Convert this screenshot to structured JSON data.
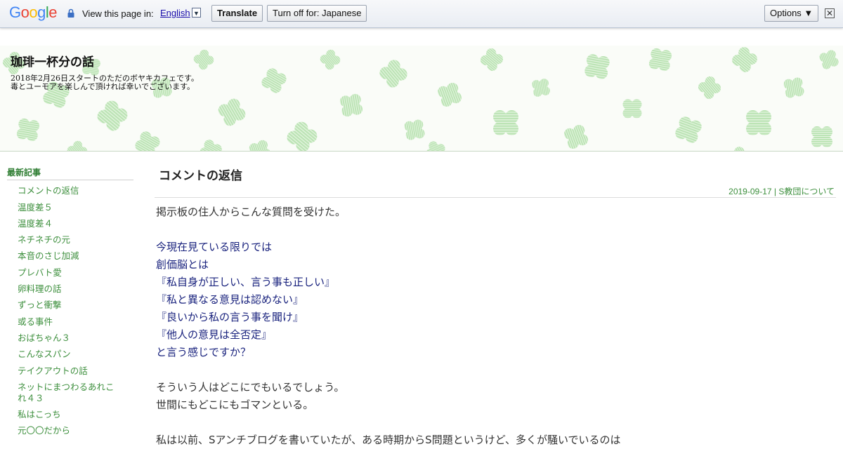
{
  "translate_bar": {
    "logo": "Google",
    "view_label": "View this page in:",
    "language": "English",
    "translate_button": "Translate",
    "turn_off_button": "Turn off for: Japanese",
    "options_button": "Options ▼",
    "close_symbol": "✕"
  },
  "header": {
    "title": "珈琲一杯分の話",
    "description_line1": "2018年2月26日スタートのただのボヤキカフェです。",
    "description_line2": "毒とユーモアを楽しんで頂ければ幸いでございます。"
  },
  "sidebar": {
    "heading": "最新記事",
    "items": [
      "コメントの返信",
      "温度差５",
      "温度差４",
      "ネチネチの元",
      "本音のさじ加減",
      "プレバト愛",
      "卵料理の話",
      "ずっと衝撃",
      "或る事件",
      "おばちゃん３",
      "こんなスパン",
      "テイクアウトの話",
      "ネットにまつわるあれこれ４３",
      "私はこっち",
      "元〇〇だから"
    ]
  },
  "post": {
    "title": "コメントの返信",
    "date": "2019-09-17",
    "separator": " | ",
    "category": "S教団について",
    "lines": [
      {
        "text": "掲示板の住人からこんな質問を受けた。",
        "style": "n"
      },
      {
        "text": "",
        "style": "gap"
      },
      {
        "text": "今現在見ている限りでは",
        "style": "q"
      },
      {
        "text": "創価脳とは",
        "style": "q"
      },
      {
        "text": "『私自身が正しい、言う事も正しい』",
        "style": "q"
      },
      {
        "text": "『私と異なる意見は認めない』",
        "style": "q"
      },
      {
        "text": "『良いから私の言う事を聞け』",
        "style": "q"
      },
      {
        "text": "『他人の意見は全否定』",
        "style": "q"
      },
      {
        "text": "と言う感じですか？",
        "style": "q"
      },
      {
        "text": "",
        "style": "gap"
      },
      {
        "text": "そういう人はどこにでもいるでしょう。",
        "style": "n"
      },
      {
        "text": "世間にもどこにもゴマンといる。",
        "style": "n"
      },
      {
        "text": "",
        "style": "gap"
      },
      {
        "text": "私は以前、Sアンチブログを書いていたが、ある時期からS問題というけど、多くが騒いでいるのは",
        "style": "n"
      }
    ]
  },
  "colors": {
    "link_green": "#3d8f3d",
    "quote_blue": "#1a237e"
  }
}
